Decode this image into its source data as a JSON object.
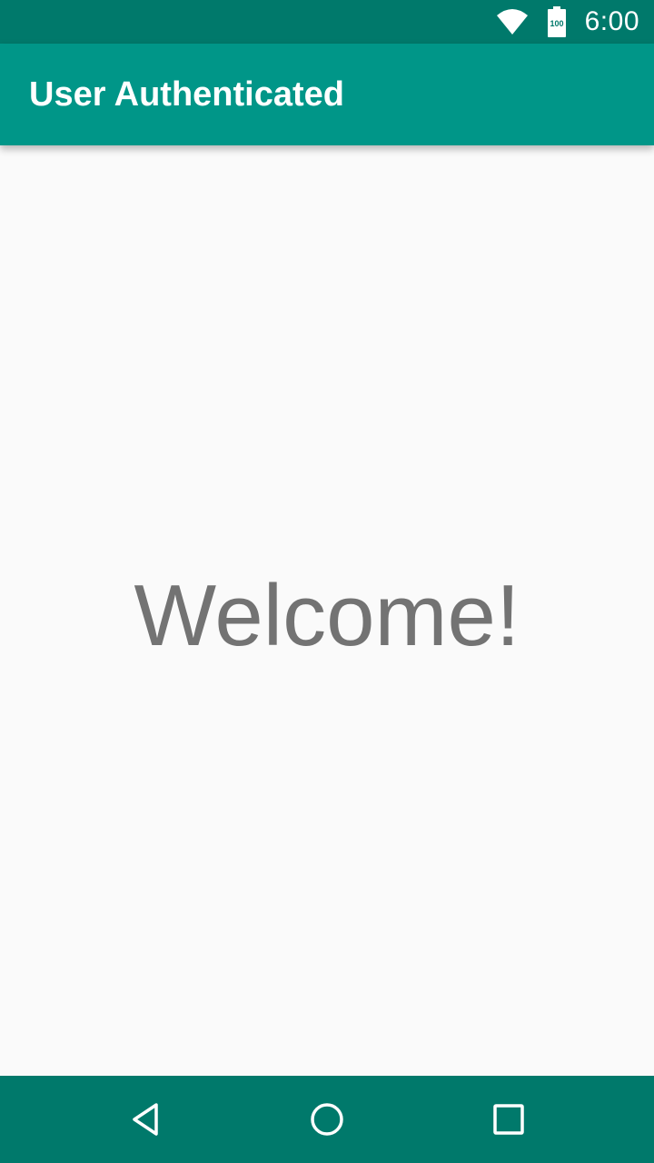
{
  "status_bar": {
    "time": "6:00",
    "battery_level": "100",
    "icons": [
      "wifi-icon",
      "battery-icon"
    ]
  },
  "app_bar": {
    "title": "User Authenticated",
    "color": "#009688"
  },
  "main": {
    "message": "Welcome!"
  },
  "nav_bar": {
    "buttons": [
      "back-icon",
      "home-icon",
      "recents-icon"
    ],
    "color": "#00796b"
  }
}
